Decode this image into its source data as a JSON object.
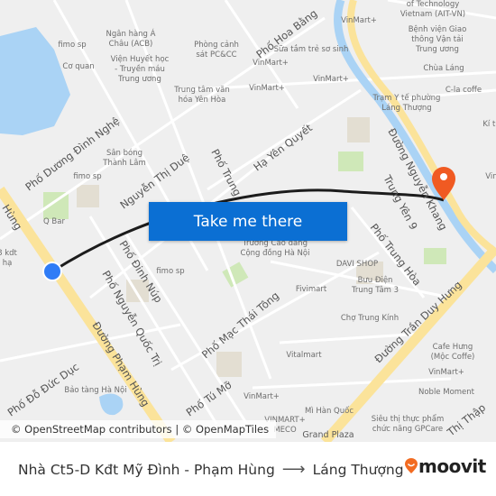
{
  "map": {
    "labels": {
      "ngan_hang": [
        "Ngân hàng Á",
        "Châu (ACB)"
      ],
      "fimo1": "fimo sp",
      "co_quan": "Cơ quan",
      "vien_huyet_hoc": [
        "Viện Huyết học",
        "- Truyền máu",
        "Trung ương"
      ],
      "phong_canh_sat": [
        "Phòng cảnh",
        "sát PC&CC"
      ],
      "trung_tam_van_hoa": [
        "Trung tâm văn",
        "hóa Yên Hòa"
      ],
      "san_bong": [
        "Sân bóng",
        "Thành Lâm"
      ],
      "fimo2": "fimo sp",
      "q_bar": "Q Bar",
      "kdt": [
        "8 kdt",
        "hạ"
      ],
      "fimo3": "fimo sp",
      "bao_tang": "Bảo tàng Hà Nội",
      "vinmart1": "VinMart+",
      "vinmart2": "VinMart+",
      "vinmart3": "VinMart+",
      "vinmart4": "VinMart+",
      "vinmart5": "VinMart+",
      "vinmart6": "VinMart+",
      "vinmart_meco": [
        "VINMART+",
        "MECO"
      ],
      "sua_tam": "Sữa tắm trẻ sơ sinh",
      "ait": [
        "of Technology",
        "Vietnam (AIT-VN)"
      ],
      "benh_vien": [
        "Bệnh viện Giao",
        "thông Vận tải",
        "Trung ương"
      ],
      "chua_lang": "Chùa Láng",
      "cla_coffe": "C-la coffe",
      "tram_y_te": [
        "Trạm Y tế phường",
        "Láng Thượng"
      ],
      "ki_tuc": "Kí tú",
      "vin_right": "Vin",
      "cao_dang": [
        "Trường Cao đẳng",
        "Cộng đồng Hà Nội"
      ],
      "davi_shop": "DAVI SHOP",
      "buu_dien": [
        "Bưu Điện",
        "Trung Tâm 3"
      ],
      "fivimart": "Fivimart",
      "cho_trung_kinh": "Chợ Trung Kính",
      "vitalmart": "Vitalmart",
      "cafe_hung": [
        "Cafe Hưng",
        "(Mộc Coffe)"
      ],
      "noble_moment": "Noble Moment",
      "mi_han_quoc": "Mì Hàn Quốc",
      "grand_plaza": "Grand Plaza",
      "sieu_thi": [
        "Siêu thị thực phẩm",
        "chức năng GPCare"
      ]
    },
    "streets": {
      "duong_dinh_nghe": "Phố Dương Đình Nghệ",
      "hoa_bang": "Phố Hoa Bằng",
      "nguyen_thi_due": "Nguyễn Thị Duệ",
      "pho_trung": "Phố Trung",
      "ha_yen_quyet": "Hạ Yên Quyết",
      "nguyen_khang": "Đường Nguyễn Khang",
      "trung_yen_9": "Trung Yên 9",
      "trung_hoa": "Phố Trung Hòa",
      "dinh_nup": "Phố Đinh Núp",
      "nguyen_quoc_tri": "Phố Nguyễn Quốc Trị",
      "pham_hung": "Đường Phạm Hùng",
      "pham_hung_top": "Hùng",
      "mac_thai_tong": "Phố Mạc Thái Tông",
      "tran_duy_hung": "Đường Trần Duy Hưng",
      "do_duc_duc": "Phố Đỗ Đức Dục",
      "tu_mo": "Phố Tú Mỡ",
      "thi_thap": "Thị Thập"
    },
    "origin_icon": "origin-dot-icon",
    "destination_icon": "destination-pin-icon",
    "colors": {
      "route": "#1c1c1c",
      "origin": "#2f7cf6",
      "destination": "#f05a22",
      "major_road": "#fbe39a",
      "water": "#aad3f5",
      "park": "#cfe8b8"
    }
  },
  "cta": {
    "label": "Take me there"
  },
  "attribution": "© OpenStreetMap contributors | © OpenMapTiles",
  "footer": {
    "origin": "Nhà Ct5-D Kđt Mỹ Đình - Phạm Hùng",
    "arrow_icon": "arrow-right-icon",
    "destination": "Láng Thượng",
    "brand": "moovit",
    "brand_color": "#f26b21"
  }
}
